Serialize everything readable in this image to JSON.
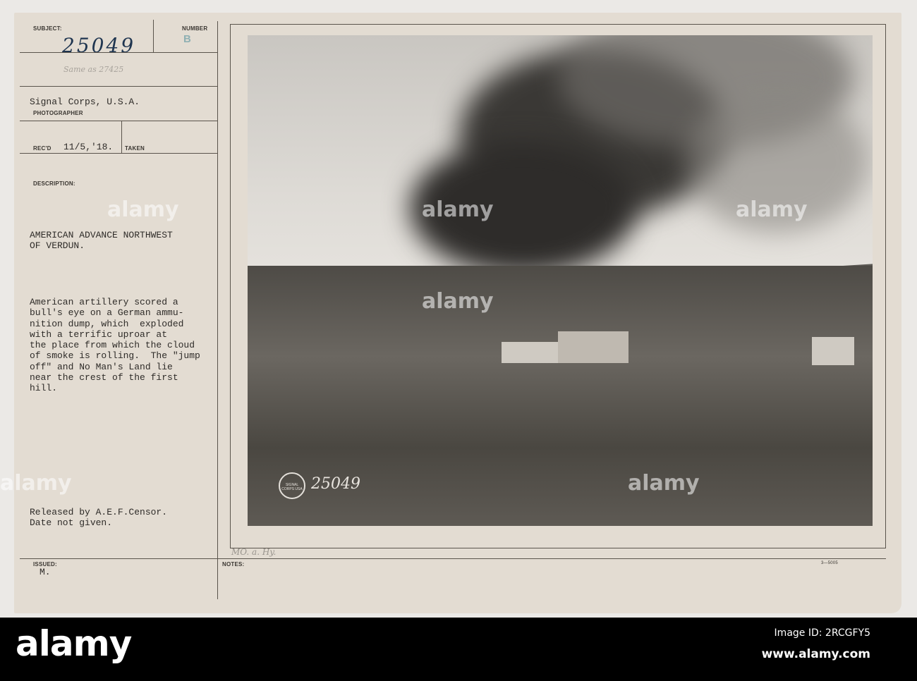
{
  "card": {
    "subject_label": "SUBJECT:",
    "subject_value": "25049",
    "number_label": "NUMBER",
    "number_stamp": "B",
    "same_as": "Same as 27425",
    "photographer_value": "Signal Corps, U.S.A.",
    "photographer_label": "PHOTOGRAPHER",
    "recd_label": "REC'D",
    "recd_value": "11/5,'18.",
    "taken_label": "TAKEN",
    "description_label": "DESCRIPTION:",
    "title_lines": [
      "AMERICAN ADVANCE NORTHWEST",
      "OF VERDUN."
    ],
    "description_lines": [
      "American artillery scored a",
      "bull's eye on a German ammu-",
      "nition dump, which  exploded",
      "with a terrific uproar at",
      "the place from which the cloud",
      "of smoke is rolling.  The \"jump",
      "off\" and No Man's Land lie",
      "near the crest of the first",
      "hill."
    ],
    "release_lines": [
      "Released by A.E.F.Censor.",
      "Date not given."
    ],
    "issued_label": "ISSUED:",
    "issued_value": "M.",
    "notes_label": "NOTES:",
    "notes_hand": "MO. a. Hy.",
    "form_number": "3—5005"
  },
  "photo": {
    "seal_text": "SIGNAL CORPS USA",
    "photo_number": "25049"
  },
  "watermark": {
    "text": "alamy",
    "image_id": "Image ID: 2RCGFY5",
    "site": "www.alamy.com"
  }
}
